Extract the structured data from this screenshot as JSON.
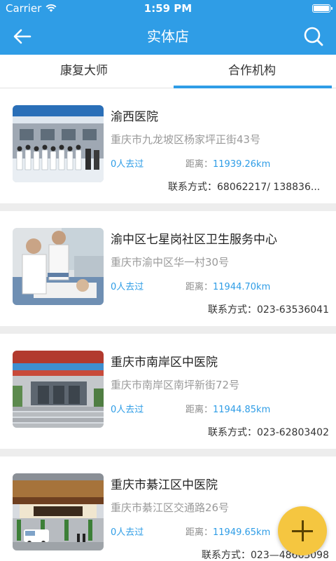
{
  "status_bar": {
    "carrier": "Carrier",
    "time": "1:59 PM"
  },
  "nav": {
    "title": "实体店"
  },
  "tabs": [
    {
      "label": "康复大师",
      "active": false
    },
    {
      "label": "合作机构",
      "active": true
    }
  ],
  "colors": {
    "accent": "#2f9de6",
    "fab": "#f5c640"
  },
  "stores": [
    {
      "name": "渝西医院",
      "address": "重庆市九龙坡区杨家坪正街43号",
      "visits": "0人去过",
      "distance_label": "距离：",
      "distance": "11939.26km",
      "contact": "联系方式：68062217/ 138836..."
    },
    {
      "name": "渝中区七星岗社区卫生服务中心",
      "address": "重庆市渝中区华一村30号",
      "visits": "0人去过",
      "distance_label": "距离：",
      "distance": "11944.70km",
      "contact": "联系方式：023-63536041"
    },
    {
      "name": "重庆市南岸区中医院",
      "address": "重庆市南岸区南坪新街72号",
      "visits": "0人去过",
      "distance_label": "距离：",
      "distance": "11944.85km",
      "contact": "联系方式：023-62803402"
    },
    {
      "name": "重庆市綦江区中医院",
      "address": "重庆市綦江区交通路26号",
      "visits": "0人去过",
      "distance_label": "距离：",
      "distance": "11949.65km",
      "contact": "联系方式：023—48663098"
    }
  ]
}
